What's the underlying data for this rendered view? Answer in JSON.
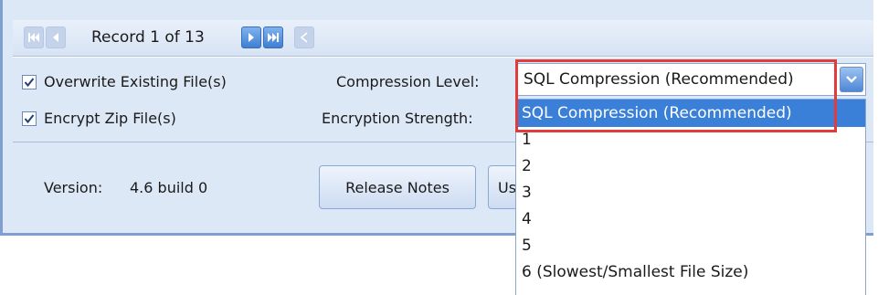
{
  "navigation": {
    "record_text": "Record 1 of 13",
    "buttons": {
      "first": {
        "icon": "first-record-icon",
        "enabled": false
      },
      "previous": {
        "icon": "previous-record-icon",
        "enabled": false
      },
      "next": {
        "icon": "next-record-icon",
        "enabled": true
      },
      "last": {
        "icon": "last-record-icon",
        "enabled": true
      },
      "new": {
        "icon": "new-record-icon",
        "enabled": false
      }
    }
  },
  "options": {
    "overwrite": {
      "label": "Overwrite Existing File(s)",
      "checked": true
    },
    "encrypt": {
      "label": "Encrypt Zip File(s)",
      "checked": true
    },
    "compression_label": "Compression Level:",
    "encryption_label": "Encryption Strength:",
    "compression": {
      "value": "SQL Compression (Recommended)",
      "options": [
        "SQL Compression (Recommended)",
        "1",
        "2",
        "3",
        "4",
        "5",
        "6 (Slowest/Smallest File Size)"
      ],
      "highlighted_index": 0
    }
  },
  "footer": {
    "version_label": "Version:",
    "version_value": "4.6 build 0",
    "release_notes_label": "Release Notes",
    "partial_button_label": "Us"
  },
  "colors": {
    "panel_bg": "#dde8f6",
    "selection": "#3a7fd8",
    "highlight_outline": "#e23b3b",
    "frame_border": "#7f9fd0"
  }
}
